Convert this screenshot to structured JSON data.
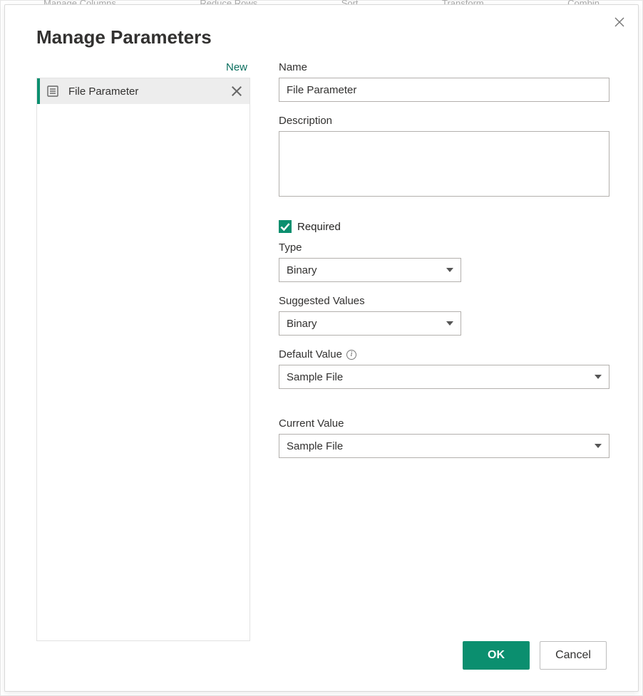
{
  "dialog": {
    "title": "Manage Parameters",
    "new_label": "New"
  },
  "parameters": {
    "items": [
      {
        "label": "File Parameter"
      }
    ]
  },
  "form": {
    "name_label": "Name",
    "name_value": "File Parameter",
    "description_label": "Description",
    "description_value": "",
    "required_label": "Required",
    "required_checked": true,
    "type_label": "Type",
    "type_value": "Binary",
    "suggested_label": "Suggested Values",
    "suggested_value": "Binary",
    "default_label": "Default Value",
    "default_value": "Sample File",
    "current_label": "Current Value",
    "current_value": "Sample File"
  },
  "footer": {
    "ok_label": "OK",
    "cancel_label": "Cancel"
  },
  "bg_ribbon": {
    "a": "Manage Columns",
    "b": "Reduce Rows",
    "c": "Sort",
    "d": "Transform",
    "e": "Combin"
  }
}
